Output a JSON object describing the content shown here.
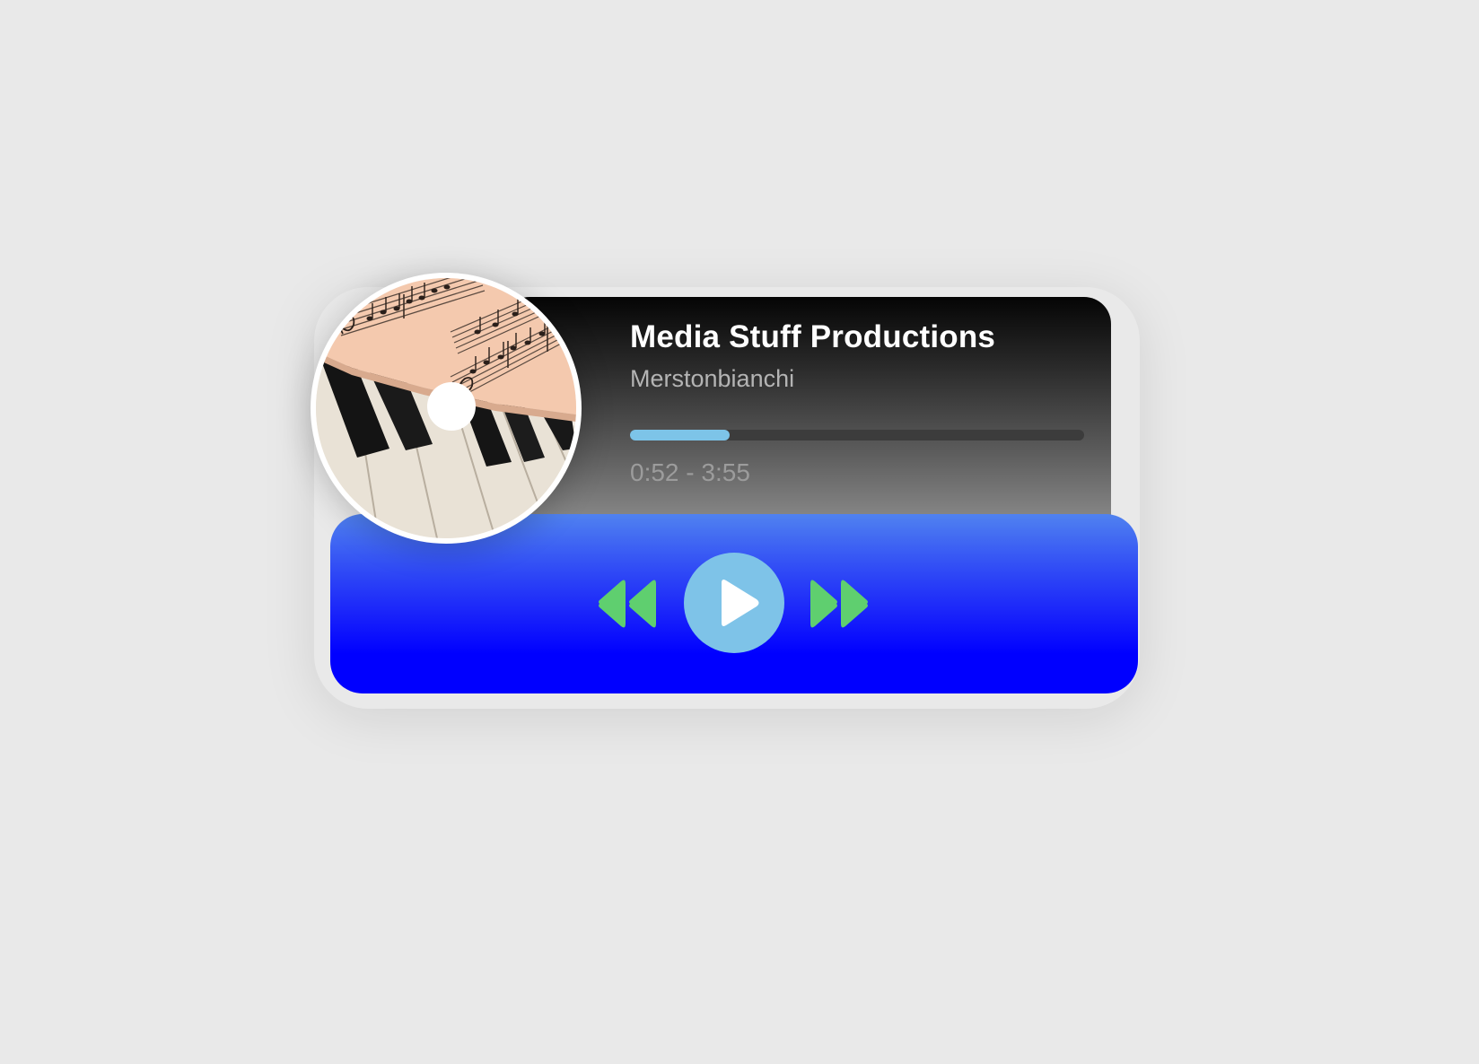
{
  "track": {
    "title": "Media Stuff Productions",
    "artist": "Merstonbianchi",
    "elapsed": "0:52",
    "separator": "-",
    "duration": "3:55",
    "progress_percent": 22
  },
  "album_art": {
    "subject": "sheet music over piano keys"
  },
  "controls": {
    "rewind_icon": "rewind-icon",
    "play_icon": "play-icon",
    "forward_icon": "fast-forward-icon"
  },
  "colors": {
    "page_background": "#e9e9e9",
    "controls_accent": "#0000ff",
    "play_button": "#7ec3e8",
    "skip_icons": "#5fcf6f",
    "progress_fill": "#7dc4e8",
    "progress_track": "#3c3c3c"
  }
}
